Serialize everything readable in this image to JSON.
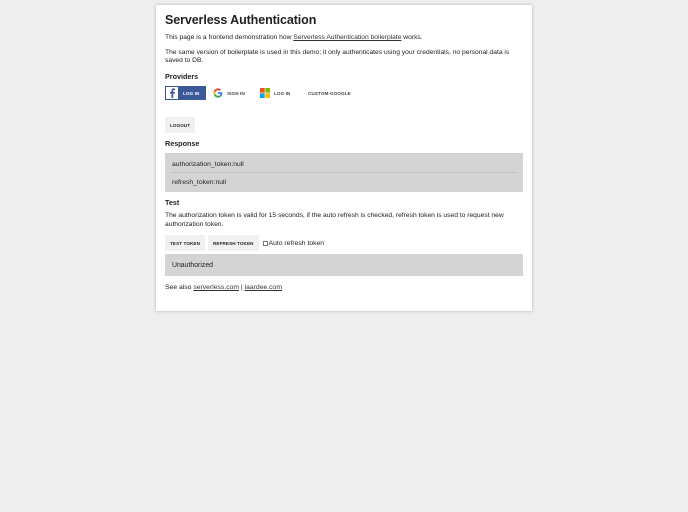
{
  "page": {
    "title": "Serverless Authentication",
    "intro_prefix": "This page is a frontend demonstration how ",
    "intro_link": "Serverless Authentication boilerplate",
    "intro_suffix": " works.",
    "same_version_text": "The same version of boilerplate is used in this demo; it only authenticates using your credentials, no personal data is saved to DB."
  },
  "providers": {
    "heading": "Providers",
    "facebook": {
      "label": "LOG IN",
      "icon": "facebook-icon",
      "color": "#3b5998"
    },
    "google": {
      "label": "SIGN IN",
      "icon": "google-icon"
    },
    "microsoft": {
      "label": "LOG IN",
      "icon": "microsoft-icon"
    },
    "custom_google": {
      "label": "CUSTOM-GOOGLE"
    }
  },
  "logout": {
    "label": "LOGOUT"
  },
  "response": {
    "heading": "Response",
    "authorization_token": "authorization_token:null",
    "refresh_token": "refresh_token:null"
  },
  "test": {
    "heading": "Test",
    "description": "The authorization token is valid for 15 seconds, if the auto refresh is checked, refresh token is used to request new authorization token.",
    "test_token_label": "TEST TOKEN",
    "refresh_token_label": "REFRESH TOKEN",
    "auto_refresh_label": "Auto refresh token",
    "auto_refresh_checked": false,
    "status": "Unauthorized"
  },
  "footer": {
    "see_also": "See also ",
    "link1": "serverless.com",
    "separator": " | ",
    "link2": "laardee.com"
  }
}
